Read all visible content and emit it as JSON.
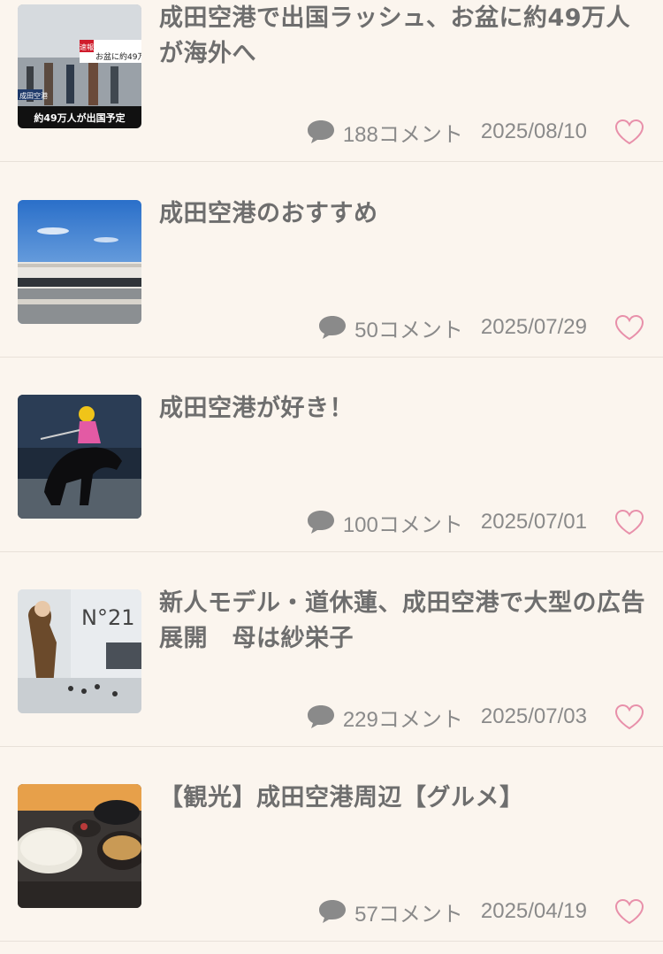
{
  "articles": [
    {
      "title": "成田空港で出国ラッシュ、お盆に約49万人が海外へ",
      "comments": "188コメント",
      "date": "2025/08/10",
      "thumb_caption": "約49万人が出国予定",
      "thumb_badge": "速報",
      "thumb_headline": "お盆に約49万",
      "thumb_location": "成田空港"
    },
    {
      "title": "成田空港のおすすめ",
      "comments": "50コメント",
      "date": "2025/07/29"
    },
    {
      "title": "成田空港が好き！",
      "comments": "100コメント",
      "date": "2025/07/01"
    },
    {
      "title": "新人モデル・道休蓮、成田空港で大型の広告展開　母は紗栄子",
      "comments": "229コメント",
      "date": "2025/07/03",
      "thumb_text": "N°21"
    },
    {
      "title": "【観光】成田空港周辺【グルメ】",
      "comments": "57コメント",
      "date": "2025/04/19"
    }
  ],
  "colors": {
    "background": "#fbf5ee",
    "title": "#6e6e6e",
    "meta": "#8a8a8a",
    "heart": "#e890aa",
    "divider": "#e8e1d9"
  },
  "icons": {
    "comment": "comment-bubble-icon",
    "favorite": "heart-outline-icon"
  }
}
